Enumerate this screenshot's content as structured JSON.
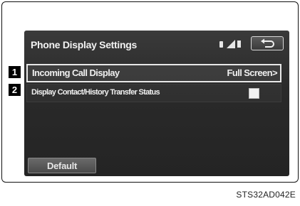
{
  "screen": {
    "title": "Phone Display Settings",
    "back_icon": "return-arrow-icon"
  },
  "status": {
    "icons": [
      "battery-icon",
      "signal-strength-icon",
      "bluetooth-icon"
    ]
  },
  "rows": [
    {
      "callout": "1",
      "label": "Incoming Call Display",
      "value": "Full Screen>"
    },
    {
      "callout": "2",
      "label": "Display Contact/History Transfer Status",
      "checkbox_checked": false
    }
  ],
  "footer": {
    "default_label": "Default"
  },
  "figure_code": "STS32AD042E"
}
